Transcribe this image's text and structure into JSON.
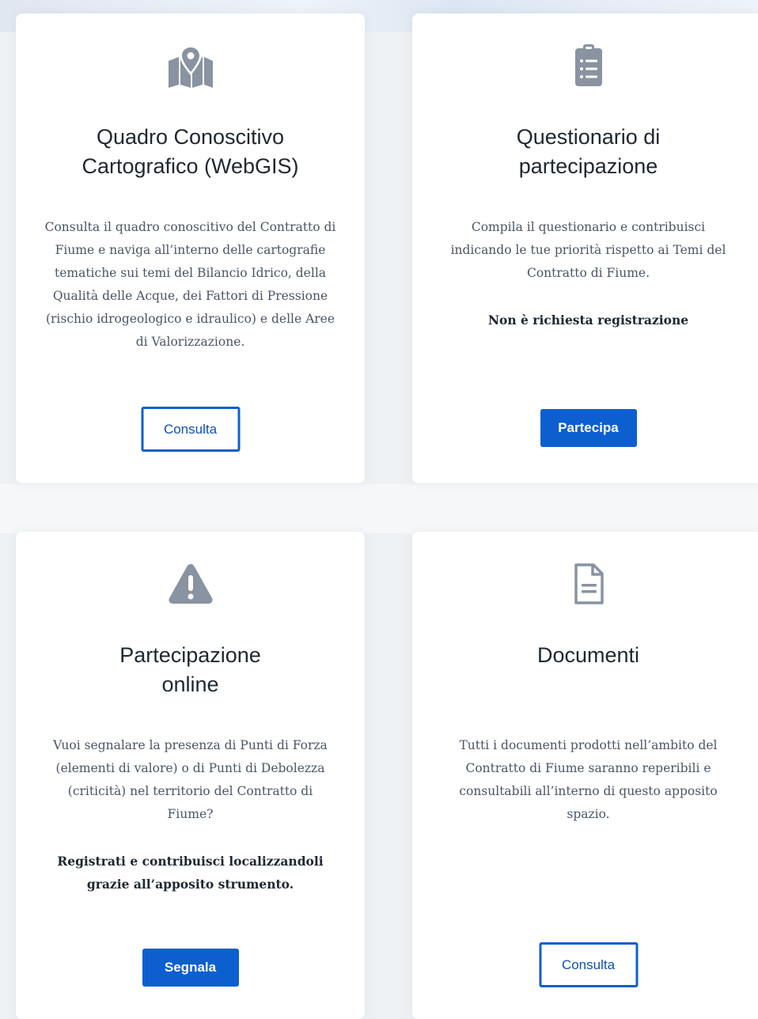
{
  "colors": {
    "accent": "#0d5fd0",
    "icon_gray": "#8993a1",
    "title": "#1f2731",
    "body_text": "#4b5563"
  },
  "cards": [
    {
      "icon": "map-pin-icon",
      "title_line1": "Quadro Conoscitivo",
      "title_line2": "Cartografico (WebGIS)",
      "text": "Consulta il quadro conoscitivo del Contratto di Fiume e naviga all’interno delle cartografie tematiche sui temi del Bilancio Idrico, della Qualità delle Acque, dei Fattori di Pressione (rischio idrogeologico e idraulico) e delle Aree di Valorizzazione.",
      "note": "",
      "button_label": "Consulta",
      "button_style": "outline"
    },
    {
      "icon": "clipboard-list-icon",
      "title_line1": "Questionario di",
      "title_line2": "partecipazione",
      "text": "Compila il questionario e contribuisci indicando le tue priorità rispetto ai Temi del Contratto di Fiume.",
      "note": "Non è richiesta registrazione",
      "button_label": "Partecipa",
      "button_style": "solid"
    },
    {
      "icon": "warning-icon",
      "title_line1": "Partecipazione",
      "title_line2": "online",
      "text": "Vuoi segnalare la presenza di Punti di Forza (elementi di valore) o di Punti di Debolezza (criticità) nel territorio del Contratto di Fiume?",
      "note": "Registrati e contribuisci localizzandoli grazie all’apposito strumento.",
      "button_label": "Segnala",
      "button_style": "solid"
    },
    {
      "icon": "document-icon",
      "title_line1": "Documenti",
      "title_line2": "",
      "text": "Tutti i documenti prodotti nell’ambito del Contratto di Fiume saranno reperibili e consultabili all’interno di questo apposito spazio.",
      "note": "",
      "button_label": "Consulta",
      "button_style": "outline"
    }
  ]
}
